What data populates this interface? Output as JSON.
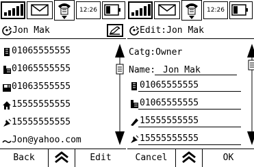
{
  "status": {
    "time": "12:26"
  },
  "left_screen": {
    "title": "Jon Mak",
    "entries": [
      {
        "icon": "desk-phone-icon",
        "value": "01065555555"
      },
      {
        "icon": "office-building-icon",
        "value": "01065555555"
      },
      {
        "icon": "fax-icon",
        "value": "01063555555"
      },
      {
        "icon": "home-icon",
        "value": "15555555555"
      },
      {
        "icon": "satellite-icon",
        "value": "15555555555"
      },
      {
        "icon": "email-icon",
        "value": "Jon@yahoo.com"
      }
    ],
    "softkeys": {
      "left": "Back",
      "right": "Edit"
    }
  },
  "right_screen": {
    "title": "Edit:Jon Mak",
    "category": "Catg:Owner",
    "name_label": "Name:",
    "name_value": "Jon Mak",
    "fields": [
      {
        "icon": "desk-phone-icon",
        "value": "01065555555"
      },
      {
        "icon": "office-building-icon",
        "value": "01065555555"
      },
      {
        "icon": "mobile-phone-icon",
        "value": "15555555555"
      },
      {
        "icon": "satellite-icon",
        "value": "15555555555"
      }
    ],
    "softkeys": {
      "left": "Cancel",
      "right": "OK"
    }
  }
}
